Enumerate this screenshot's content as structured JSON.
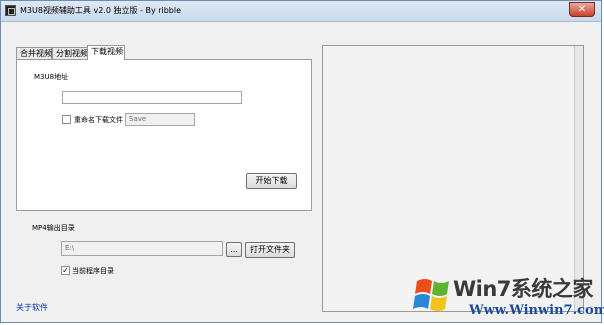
{
  "window": {
    "title": "M3U8视频辅助工具 v2.0 独立版    - By ribble",
    "close_glyph": "✕"
  },
  "tabs": [
    {
      "label": "合并视频",
      "active": false
    },
    {
      "label": "分割视频",
      "active": false
    },
    {
      "label": "下载视频",
      "active": true
    }
  ],
  "download_tab": {
    "m3u8_label": "M3U8地址",
    "m3u8_value": "",
    "rename_label": "重命名下载文件",
    "rename_checked": false,
    "rename_value": "Save",
    "start_button": "开始下载"
  },
  "output": {
    "label": "MP4输出目录",
    "path_value": "E:\\",
    "browse_button": "...",
    "open_folder_button": "打开文件夹",
    "current_dir_label": "当前程序目录",
    "current_dir_checked": true,
    "check_glyph": "✓"
  },
  "footer": {
    "about_link": "关于软件"
  },
  "watermark": {
    "site_name": "Win7系统之家",
    "url": "Www.Winwin7.com",
    "colors": [
      "#e94e1b",
      "#5cb531",
      "#2a86d8",
      "#f3c31a"
    ]
  }
}
